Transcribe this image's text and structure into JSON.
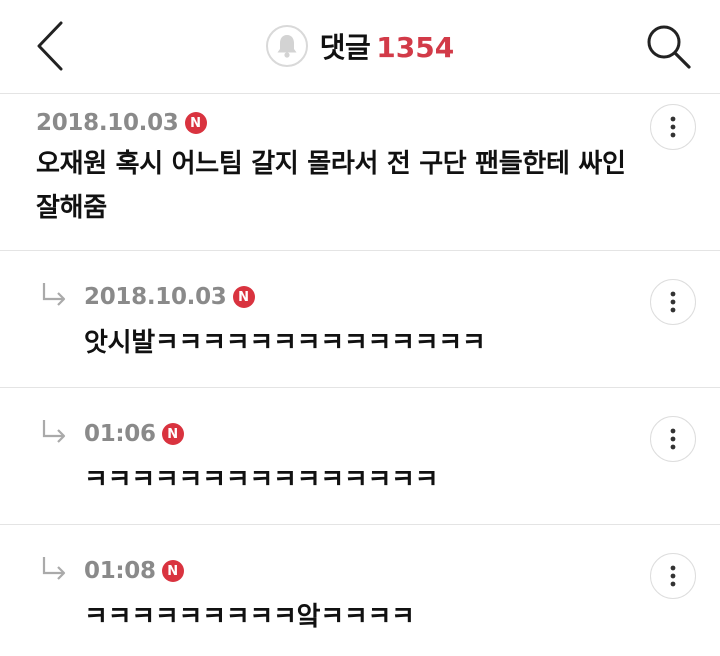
{
  "header": {
    "title": "댓글",
    "count": "1354",
    "back_icon": "back-chevron-icon",
    "search_icon": "search-icon",
    "bell_icon": "bell-icon",
    "accent_color": "#d23a48"
  },
  "comments": [
    {
      "date": "2018.10.03",
      "badge": "N",
      "text_line1": "오재원 혹시 어느팀 갈지 몰라서 전 구단 팬들한테 싸인",
      "text_line2": "잘해줌",
      "is_reply": false
    },
    {
      "date": "2018.10.03",
      "badge": "N",
      "text_line1": "앗시발ㅋㅋㅋㅋㅋㅋㅋㅋㅋㅋㅋㅋㅋㅋ",
      "is_reply": true
    },
    {
      "date": "01:06",
      "badge": "N",
      "text_line1": "ㅋㅋㅋㅋㅋㅋㅋㅋㅋㅋㅋㅋㅋㅋㅋ",
      "is_reply": true
    },
    {
      "date": "01:08",
      "badge": "N",
      "text_line1": "ㅋㅋㅋㅋㅋㅋㅋㅋㅋ앜ㅋㅋㅋㅋ",
      "is_reply": true
    }
  ]
}
